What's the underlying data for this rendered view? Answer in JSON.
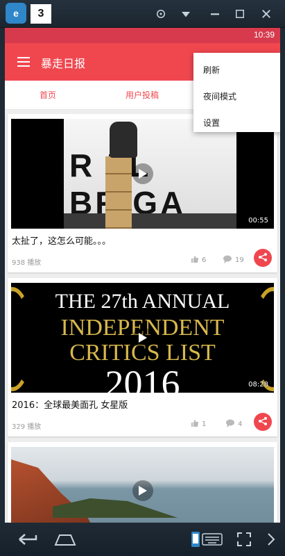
{
  "status": {
    "time": "10:39"
  },
  "app": {
    "title": "暴走日报"
  },
  "tabs": [
    {
      "label": "首页"
    },
    {
      "label": "用户投稿"
    }
  ],
  "popup_menu": {
    "items": [
      "刷新",
      "夜间模式",
      "设置"
    ]
  },
  "cards": [
    {
      "title": "太扯了，这怎么可能。。。",
      "plays": "938 播放",
      "likes": "6",
      "comments": "19",
      "duration": "00:55"
    },
    {
      "title": "2016：全球最美面孔 女星版",
      "plays": "329 播放",
      "likes": "1",
      "comments": "4",
      "duration": "08:28"
    },
    {
      "title": "",
      "plays": "",
      "likes": "",
      "comments": "",
      "duration": ""
    }
  ],
  "artwork": {
    "video1_text": "R LL BRIGA",
    "video2_lines": [
      "THE 27th ANNUAL",
      "INDEPENDENT",
      "CRITICS LIST",
      "2016"
    ]
  },
  "colors": {
    "accent": "#f0474f",
    "status_bar": "#d63a4c"
  }
}
